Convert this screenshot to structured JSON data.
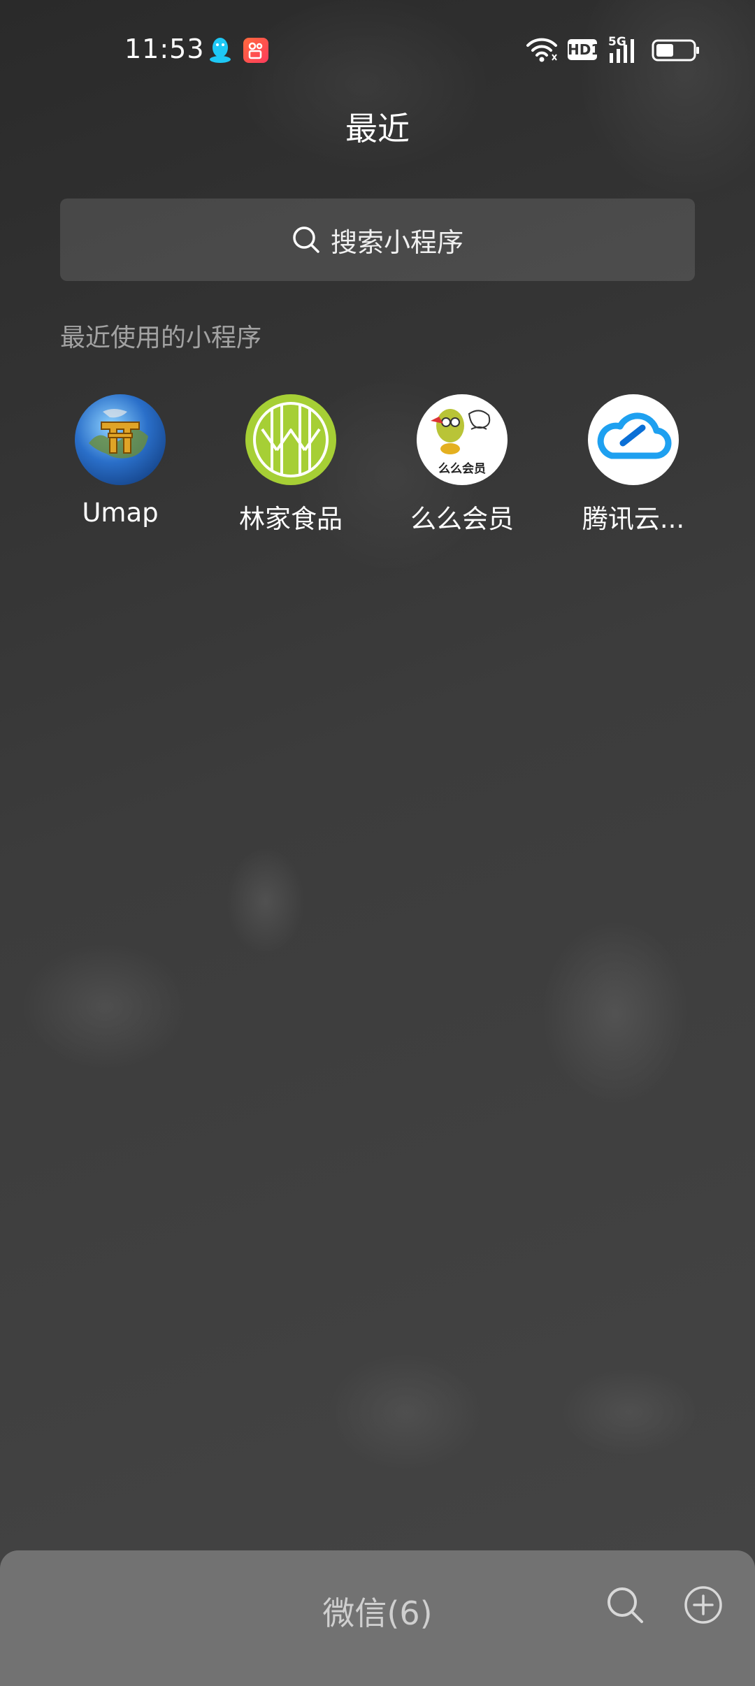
{
  "status_bar": {
    "time": "11:53",
    "hd_label": "HD1",
    "network_label": "5G"
  },
  "header": {
    "title": "最近"
  },
  "search": {
    "placeholder": "搜索小程序"
  },
  "recent": {
    "section_label": "最近使用的小程序",
    "apps": [
      {
        "label": "Umap",
        "icon": "umap-globe-icon"
      },
      {
        "label": "林家食品",
        "icon": "linjia-logo-icon",
        "accent": "#9ccc2c"
      },
      {
        "label": "么么会员",
        "icon": "memehuiyuan-logo-icon",
        "icon_text": "么么会员"
      },
      {
        "label": "腾讯云...",
        "icon": "tencent-cloud-icon",
        "accent": "#1ea0f0"
      }
    ]
  },
  "bottom_bar": {
    "title": "微信(6)"
  },
  "colors": {
    "background": "#3a3a3a",
    "bottom_bar": "#727272",
    "kuaishou": "#ff3b5c",
    "qq": "#1ec8f5"
  }
}
